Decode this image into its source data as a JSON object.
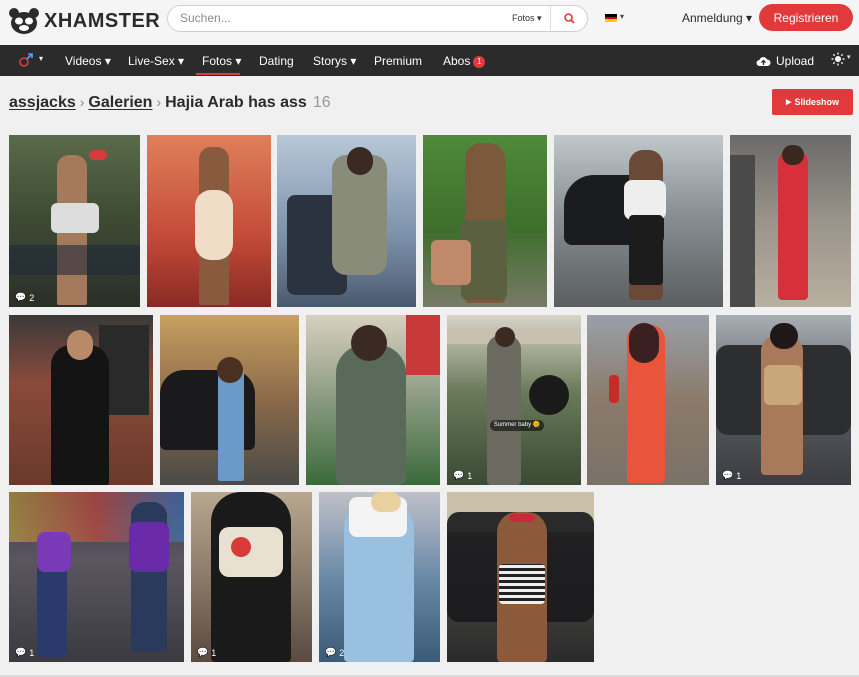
{
  "header": {
    "logo_text": "XHAMSTER",
    "search_placeholder": "Suchen...",
    "search_filter": "Fotos",
    "language_flag": "german-flag",
    "login_label": "Anmeldung",
    "register_label": "Registrieren"
  },
  "nav": {
    "items": [
      {
        "label": "Videos"
      },
      {
        "label": "Live-Sex"
      },
      {
        "label": "Fotos"
      },
      {
        "label": "Dating"
      },
      {
        "label": "Storys"
      },
      {
        "label": "Premium"
      },
      {
        "label": "Abos",
        "badge": "1"
      }
    ],
    "upload_label": "Upload",
    "active_item": "Fotos"
  },
  "breadcrumb": {
    "user": "assjacks",
    "section": "Galerien",
    "title": "Hajia Arab has ass",
    "count": "16"
  },
  "slideshow_label": "Slideshow",
  "gallery": {
    "photos": [
      {
        "comments": "2"
      },
      {
        "comments": ""
      },
      {
        "comments": ""
      },
      {
        "comments": ""
      },
      {
        "comments": ""
      },
      {
        "comments": ""
      },
      {
        "comments": ""
      },
      {
        "comments": ""
      },
      {
        "comments": ""
      },
      {
        "comments": "1",
        "caption": "Summer baby"
      },
      {
        "comments": ""
      },
      {
        "comments": "1"
      },
      {
        "comments": "1"
      },
      {
        "comments": "1"
      },
      {
        "comments": "2"
      },
      {
        "comments": ""
      }
    ]
  },
  "colors": {
    "accent": "#e2393c",
    "nav_bg": "#2b2b2b",
    "page_bg": "#f0f0f0"
  }
}
